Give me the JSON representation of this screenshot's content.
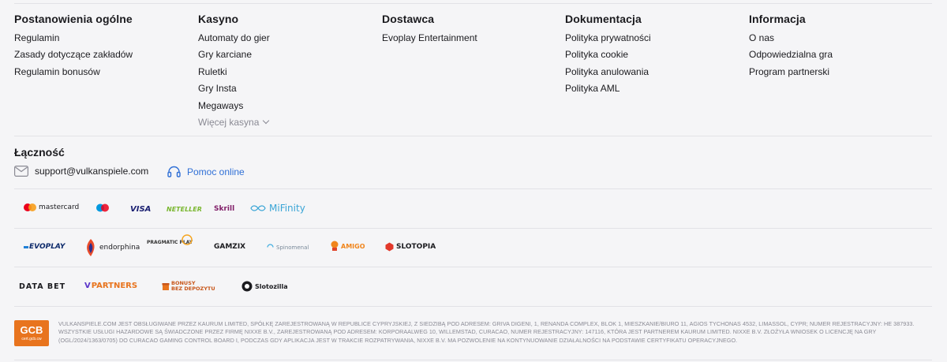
{
  "columns": [
    {
      "title": "Postanowienia ogólne",
      "links": [
        "Regulamin",
        "Zasady dotyczące zakładów",
        "Regulamin bonusów"
      ]
    },
    {
      "title": "Kasyno",
      "links": [
        "Automaty do gier",
        "Gry karciane",
        "Ruletki",
        "Gry Insta",
        "Megaways"
      ],
      "more": "Więcej kasyna"
    },
    {
      "title": "Dostawca",
      "links": [
        "Evoplay Entertainment"
      ]
    },
    {
      "title": "Dokumentacja",
      "links": [
        "Polityka prywatności",
        "Polityka cookie",
        "Polityka anulowania",
        "Polityka AML"
      ]
    },
    {
      "title": "Informacja",
      "links": [
        "O nas",
        "Odpowiedzialna gra",
        "Program partnerski"
      ]
    }
  ],
  "contact": {
    "title": "Łączność",
    "email": "support@vulkanspiele.com",
    "help": "Pomoc online"
  },
  "payments": {
    "mastercard": "mastercard",
    "visa": "VISA",
    "neteller": "NETELLER",
    "skrill": "Skrill",
    "mifinity": "MiFinity"
  },
  "providers": {
    "evoplay": "EVOPLAY",
    "endorphina": "endorphina",
    "pragmatic": "PRAGMATIC PLAY",
    "gamzix": "GAMZIX",
    "spinomenal": "Spinomenal",
    "amigo": "AMIGO",
    "slotopia": "SLOTOPIA"
  },
  "partners": {
    "databet": "DATA BET",
    "vpartners": "PARTNERS",
    "bonusy1": "BONUSY",
    "bonusy2": "BEZ DEPOZYTU",
    "slotozilla": "Slotozilla"
  },
  "gcb": {
    "title": "GCB",
    "sub": "cert.gcb.cw"
  },
  "legal": "Vulkanspiele.com jest obsługiwane przez Kaurum Limited, spółkę zarejestrowaną w Republice Cypryjskiej, z siedzibą pod adresem: Griva Digeni, 1, Renanda Complex, Blok 1, Mieszkanie/Biuro 11, Agios Tychonas 4532, Limassol, Cypr; numer rejestracyjny: HE 387933. Wszystkie usługi hazardowe są świadczone przez firmę Nixxe B.V., zarejestrowaną pod adresem: Korporaalweg 10, Willemstad, Curacao, numer rejestracyjny: 147116, która jest partnerem Kaurum Limited. Nixxe B.V. złożyła wniosek o licencję na gry (OGL/2024/1363/0705) do Curacao Gaming Control Board i, podczas gdy aplikacja jest w trakcie rozpatrywania, Nixxe B.V. ma pozwolenie na kontynuowanie działalności na podstawie certyfikatu operacyjnego.",
  "colors": {
    "accent": "#2f6fd6",
    "divider": "#e2e2e6",
    "muted": "#8a8a94"
  }
}
